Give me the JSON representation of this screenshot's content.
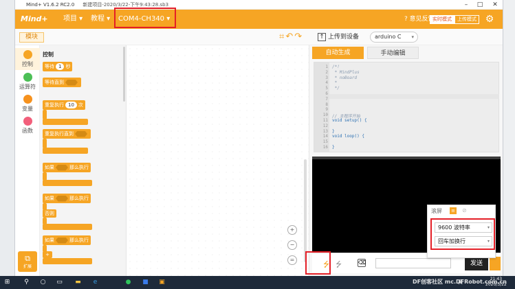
{
  "window": {
    "app_name": "Mind+ V1.6.2 RC2.0",
    "file_title": "新建项目-2020/3/22-下午9:43:28.sb3"
  },
  "menu": {
    "logo": "Mind+",
    "project": "项目 ▾",
    "tutorial": "教程 ▾",
    "port": "COM4-CH340 ▾",
    "help": "意见反馈",
    "mode_realtime": "实时模式",
    "mode_upload": "上传模式"
  },
  "toolbar": {
    "module": "模块",
    "upload": "上传到设备",
    "board": "arduino C"
  },
  "categories": [
    {
      "label": "控制",
      "color": "#f6a524"
    },
    {
      "label": "运算符",
      "color": "#4cbf56"
    },
    {
      "label": "变量",
      "color": "#f6921e"
    },
    {
      "label": "函数",
      "color": "#f25f7b"
    }
  ],
  "extensions_label": "扩展",
  "palette": {
    "title": "控制",
    "wait": "等待",
    "wait_value": "1",
    "wait_unit": "秒",
    "wait_until": "等待直到",
    "repeat": "重复执行",
    "repeat_value": "10",
    "repeat_unit": "次",
    "repeat_until": "重复执行直到",
    "if": "如果",
    "then": "那么执行",
    "else": "否则",
    "plus": "+"
  },
  "code_tabs": {
    "auto": "自动生成",
    "manual": "手动编辑"
  },
  "code_lines": [
    {
      "n": "1",
      "t": "/*!",
      "c": true
    },
    {
      "n": "2",
      "t": " * MindPlus",
      "c": true
    },
    {
      "n": "3",
      "t": " * noBoard",
      "c": true
    },
    {
      "n": "4",
      "t": " *",
      "c": true
    },
    {
      "n": "5",
      "t": " */",
      "c": true
    },
    {
      "n": "6",
      "t": "",
      "c": false
    },
    {
      "n": "7",
      "t": "",
      "c": false
    },
    {
      "n": "8",
      "t": "",
      "c": false
    },
    {
      "n": "9",
      "t": "",
      "c": false
    },
    {
      "n": "10",
      "t": "// 主程序开始",
      "c": true
    },
    {
      "n": "11",
      "t": "void setup() {",
      "c": false
    },
    {
      "n": "12",
      "t": "",
      "c": false
    },
    {
      "n": "13",
      "t": "}",
      "c": false
    },
    {
      "n": "14",
      "t": "void loop() {",
      "c": false
    },
    {
      "n": "15",
      "t": "",
      "c": false
    },
    {
      "n": "16",
      "t": "}",
      "c": false
    }
  ],
  "serial": {
    "scroll": "滚屏",
    "baud": "9600 波特率",
    "line_ending": "回车加换行",
    "send": "发送"
  },
  "taskbar": {
    "lang": "英",
    "time": "21:43",
    "date": "2020/3/22"
  },
  "watermark": "DF创客社区 mc.DFRobot.com.cn"
}
